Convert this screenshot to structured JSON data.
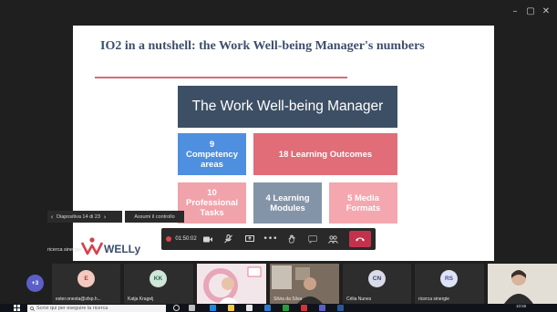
{
  "window": {
    "minimize_glyph": "–",
    "maximize_glyph": "▢",
    "close_glyph": "✕"
  },
  "slide": {
    "title": "IO2 in a nutshell: the Work Well-being Manager's numbers",
    "main_box": "The Work Well-being Manager",
    "boxes": {
      "competency_number": "9",
      "competency_label": "Competency areas",
      "learning_outcomes": "18 Learning Outcomes",
      "tasks_number": "10",
      "tasks_label": "Professional Tasks",
      "modules": "4 Learning Modules",
      "media": "5 Media Formats"
    },
    "logo_text": "WELLy",
    "colors": {
      "navy": "#3d4f64",
      "blue": "#4f8fe0",
      "red": "#e06d78",
      "pink": "#f1a3ab",
      "grey": "#8494a8"
    }
  },
  "presentation_nav": {
    "prev_icon": "chevron-left-icon",
    "slide_counter": "Diapositiva 14 di 23",
    "next_icon": "chevron-right-icon",
    "control_button": "Assumi il controllo"
  },
  "presenter": {
    "name": "ricerca sinergie"
  },
  "toolbar": {
    "recording_icon": "record-dot-icon",
    "timer": "01:50:02",
    "icons": [
      "camera-icon",
      "mic-off-icon",
      "share-screen-icon",
      "more-options-icon",
      "raise-hand-icon",
      "chat-icon",
      "participants-icon",
      "hang-up-icon"
    ]
  },
  "participants": {
    "more_count": "+3",
    "tiles": [
      {
        "initials": "E",
        "name": "ester.onesta@sfsp.h...",
        "color": "#f4c9c0",
        "text_color": "#a04040"
      },
      {
        "initials": "KK",
        "name": "Katja Kragelj",
        "color": "#cfe6d9",
        "text_color": "#2b6a4a"
      },
      {
        "initials": "",
        "name": "",
        "color": "#f3d6dc"
      },
      {
        "initials": "",
        "name": "Silvia da Silva",
        "color": "#7a6a5a"
      },
      {
        "initials": "CN",
        "name": "Célia Nunes",
        "color": "#d8dbe8",
        "text_color": "#3b4273"
      },
      {
        "initials": "RS",
        "name": "ricerca sinergie",
        "color": "#dfe3f7",
        "text_color": "#4a4fa3"
      },
      {
        "initials": "",
        "name": "",
        "color": "#d9d4cc"
      }
    ]
  },
  "taskbar": {
    "search_placeholder": "Scrivi qui per eseguire la ricerca",
    "time": "10:55"
  }
}
